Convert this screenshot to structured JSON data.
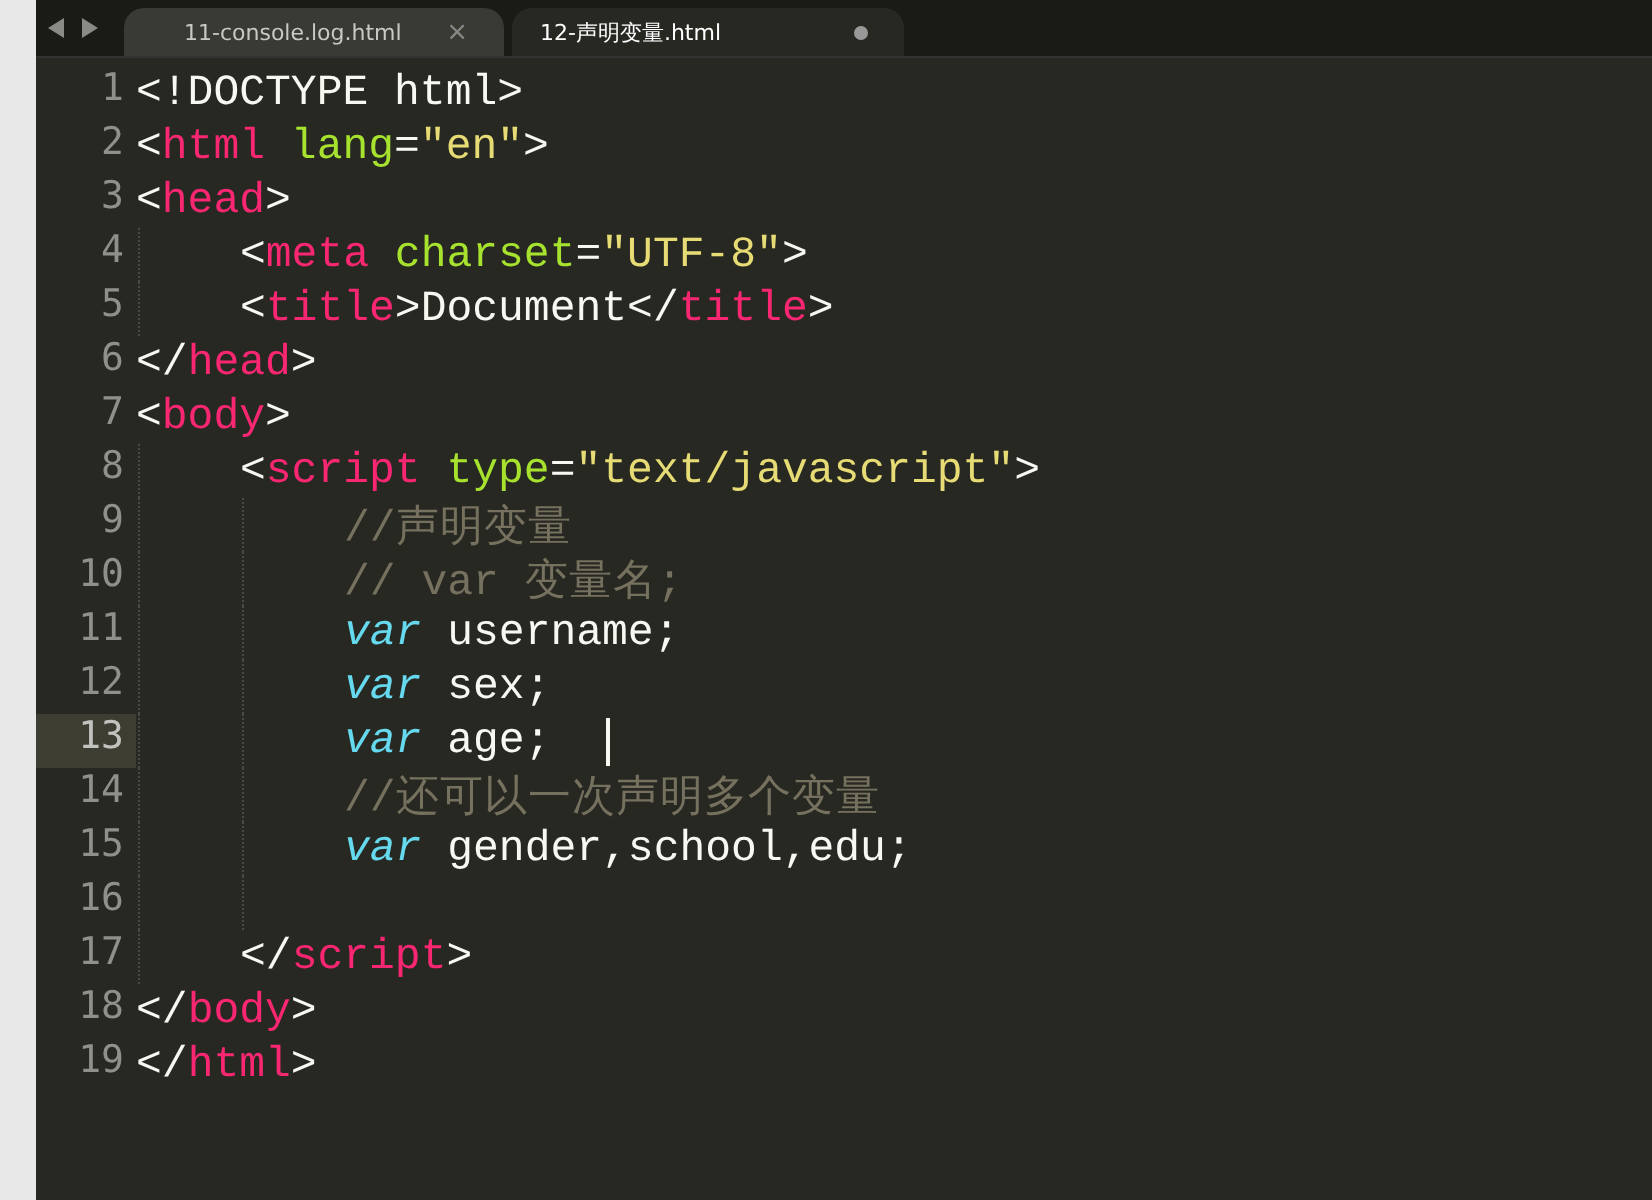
{
  "tabs": [
    {
      "label": "11-console.log.html",
      "selected": false,
      "modified": false,
      "close": "×"
    },
    {
      "label": "12-声明变量.html",
      "selected": true,
      "modified": true
    }
  ],
  "lines": [
    {
      "number": "1",
      "current": false,
      "tokens": [
        {
          "kind": "punct",
          "text": "<!DOCTYPE html>"
        }
      ]
    },
    {
      "number": "2",
      "current": false,
      "tokens": [
        {
          "kind": "punct",
          "text": "<"
        },
        {
          "kind": "tag",
          "text": "html"
        },
        {
          "kind": "attr",
          "text": " lang"
        },
        {
          "kind": "punct",
          "text": "="
        },
        {
          "kind": "string",
          "text": "\"en\""
        },
        {
          "kind": "punct",
          "text": ">"
        }
      ]
    },
    {
      "number": "3",
      "current": false,
      "tokens": [
        {
          "kind": "punct",
          "text": "<"
        },
        {
          "kind": "tag",
          "text": "head"
        },
        {
          "kind": "punct",
          "text": ">"
        }
      ],
      "children": [
        {
          "number": "4",
          "current": false,
          "tokens": [
            {
              "kind": "punct",
              "text": "<"
            },
            {
              "kind": "tag",
              "text": "meta"
            },
            {
              "kind": "attr",
              "text": " charset"
            },
            {
              "kind": "punct",
              "text": "="
            },
            {
              "kind": "string",
              "text": "\"UTF-8\""
            },
            {
              "kind": "punct",
              "text": ">"
            }
          ]
        },
        {
          "number": "5",
          "current": false,
          "tokens": [
            {
              "kind": "punct",
              "text": "<"
            },
            {
              "kind": "tag",
              "text": "title"
            },
            {
              "kind": "punct",
              "text": ">Document</"
            },
            {
              "kind": "tag",
              "text": "title"
            },
            {
              "kind": "punct",
              "text": ">"
            }
          ]
        }
      ]
    },
    {
      "number": "6",
      "current": false,
      "tokens": [
        {
          "kind": "punct",
          "text": "</"
        },
        {
          "kind": "tag",
          "text": "head"
        },
        {
          "kind": "punct",
          "text": ">"
        }
      ]
    },
    {
      "number": "7",
      "current": false,
      "tokens": [
        {
          "kind": "punct",
          "text": "<"
        },
        {
          "kind": "tag",
          "text": "body"
        },
        {
          "kind": "punct",
          "text": ">"
        }
      ],
      "children": [
        {
          "number": "8",
          "current": false,
          "tokens": [
            {
              "kind": "punct",
              "text": "<"
            },
            {
              "kind": "tag",
              "text": "script"
            },
            {
              "kind": "attr",
              "text": " type"
            },
            {
              "kind": "punct",
              "text": "="
            },
            {
              "kind": "string",
              "text": "\"text/javascript\""
            },
            {
              "kind": "punct",
              "text": ">"
            }
          ],
          "children": [
            {
              "number": "9",
              "current": false,
              "tokens": [
                {
                  "kind": "comment",
                  "text": "//声明变量"
                }
              ]
            },
            {
              "number": "10",
              "current": false,
              "tokens": [
                {
                  "kind": "comment",
                  "text": "// var 变量名;"
                }
              ]
            },
            {
              "number": "11",
              "current": false,
              "tokens": [
                {
                  "kind": "keyword",
                  "text": "var"
                },
                {
                  "kind": "punct",
                  "text": " username;"
                }
              ]
            },
            {
              "number": "12",
              "current": false,
              "tokens": [
                {
                  "kind": "keyword",
                  "text": "var"
                },
                {
                  "kind": "punct",
                  "text": " sex;"
                }
              ]
            },
            {
              "number": "13",
              "current": true,
              "tokens": [
                {
                  "kind": "keyword",
                  "text": "var"
                },
                {
                  "kind": "punct",
                  "text": " age;"
                }
              ]
            },
            {
              "number": "14",
              "current": false,
              "tokens": [
                {
                  "kind": "comment",
                  "text": "//还可以一次声明多个变量"
                }
              ]
            },
            {
              "number": "15",
              "current": false,
              "tokens": [
                {
                  "kind": "keyword",
                  "text": "var"
                },
                {
                  "kind": "punct",
                  "text": " gender,school,edu;"
                }
              ]
            },
            {
              "number": "16",
              "current": false
            }
          ]
        },
        {
          "number": "17",
          "current": false,
          "tokens": [
            {
              "kind": "punct",
              "text": "</"
            },
            {
              "kind": "tag",
              "text": "script"
            },
            {
              "kind": "punct",
              "text": ">"
            }
          ]
        }
      ]
    },
    {
      "number": "18",
      "current": false,
      "tokens": [
        {
          "kind": "punct",
          "text": "</"
        },
        {
          "kind": "tag",
          "text": "body"
        },
        {
          "kind": "punct",
          "text": ">"
        }
      ]
    },
    {
      "number": "19",
      "current": false,
      "tokens": [
        {
          "kind": "punct",
          "text": "</"
        },
        {
          "kind": "tag",
          "text": "html"
        },
        {
          "kind": "punct",
          "text": ">"
        }
      ]
    }
  ]
}
